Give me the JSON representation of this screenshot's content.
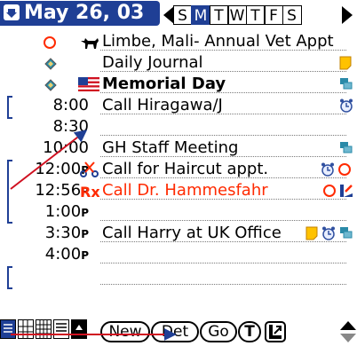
{
  "header": {
    "date": "May 26, 03",
    "week_days": [
      "S",
      "M",
      "T",
      "W",
      "T",
      "F",
      "S"
    ],
    "selected_day_index": 1
  },
  "rows": [
    {
      "time": "",
      "suffix": "",
      "desc": "Limbe, Mali- Annual Vet Appt",
      "lead": "circle-red-icon",
      "pre_icon": "dog-icon",
      "right_icons": []
    },
    {
      "time": "",
      "suffix": "",
      "desc": "Daily Journal",
      "lead": "diamond-icon",
      "pre_icon": "",
      "right_icons": [
        "note-icon"
      ]
    },
    {
      "time": "",
      "suffix": "",
      "desc": "Memorial Day",
      "lead": "diamond-icon",
      "pre_icon": "us-flag-icon",
      "right_icons": [
        "stack-icon"
      ]
    },
    {
      "time": "8:00",
      "suffix": "",
      "desc": "Call Hiragawa/J",
      "lead": "",
      "pre_icon": "",
      "right_icons": [
        "alarm-icon"
      ]
    },
    {
      "time": "8:30",
      "suffix": "",
      "desc": "",
      "lead": "",
      "pre_icon": "",
      "right_icons": []
    },
    {
      "time": "10:00",
      "suffix": "",
      "desc": "GH Staff Meeting",
      "lead": "",
      "pre_icon": "",
      "right_icons": [
        "stack-icon"
      ]
    },
    {
      "time": "12:00",
      "suffix": "P",
      "desc": "Call for Haircut appt.",
      "lead": "",
      "pre_icon": "scissors-icon",
      "right_icons": [
        "alarm-icon",
        "circle-red-icon"
      ]
    },
    {
      "time": "12:56",
      "suffix": "P",
      "desc": "Call Dr. Hammesfahr",
      "lead": "",
      "pre_icon": "rx-icon",
      "right_icons": [
        "circle-red-icon",
        "chart-icon"
      ]
    },
    {
      "time": "1:00",
      "suffix": "P",
      "desc": "",
      "lead": "",
      "pre_icon": "",
      "right_icons": []
    },
    {
      "time": "3:30",
      "suffix": "P",
      "desc": "Call Harry at UK Office",
      "lead": "",
      "pre_icon": "",
      "right_icons": [
        "note-icon",
        "alarm-icon",
        "stack-icon"
      ]
    },
    {
      "time": "4:00",
      "suffix": "P",
      "desc": "",
      "lead": "",
      "pre_icon": "",
      "right_icons": []
    }
  ],
  "bottom": {
    "new_label": "New",
    "details_label": "Det",
    "go_label": "Go",
    "t_label": "T"
  },
  "colors": {
    "accent": "#1f3f95",
    "alert_red": "#ff2a00",
    "note_yellow": "#ffc200",
    "stack_teal": "#2a8aa8"
  }
}
